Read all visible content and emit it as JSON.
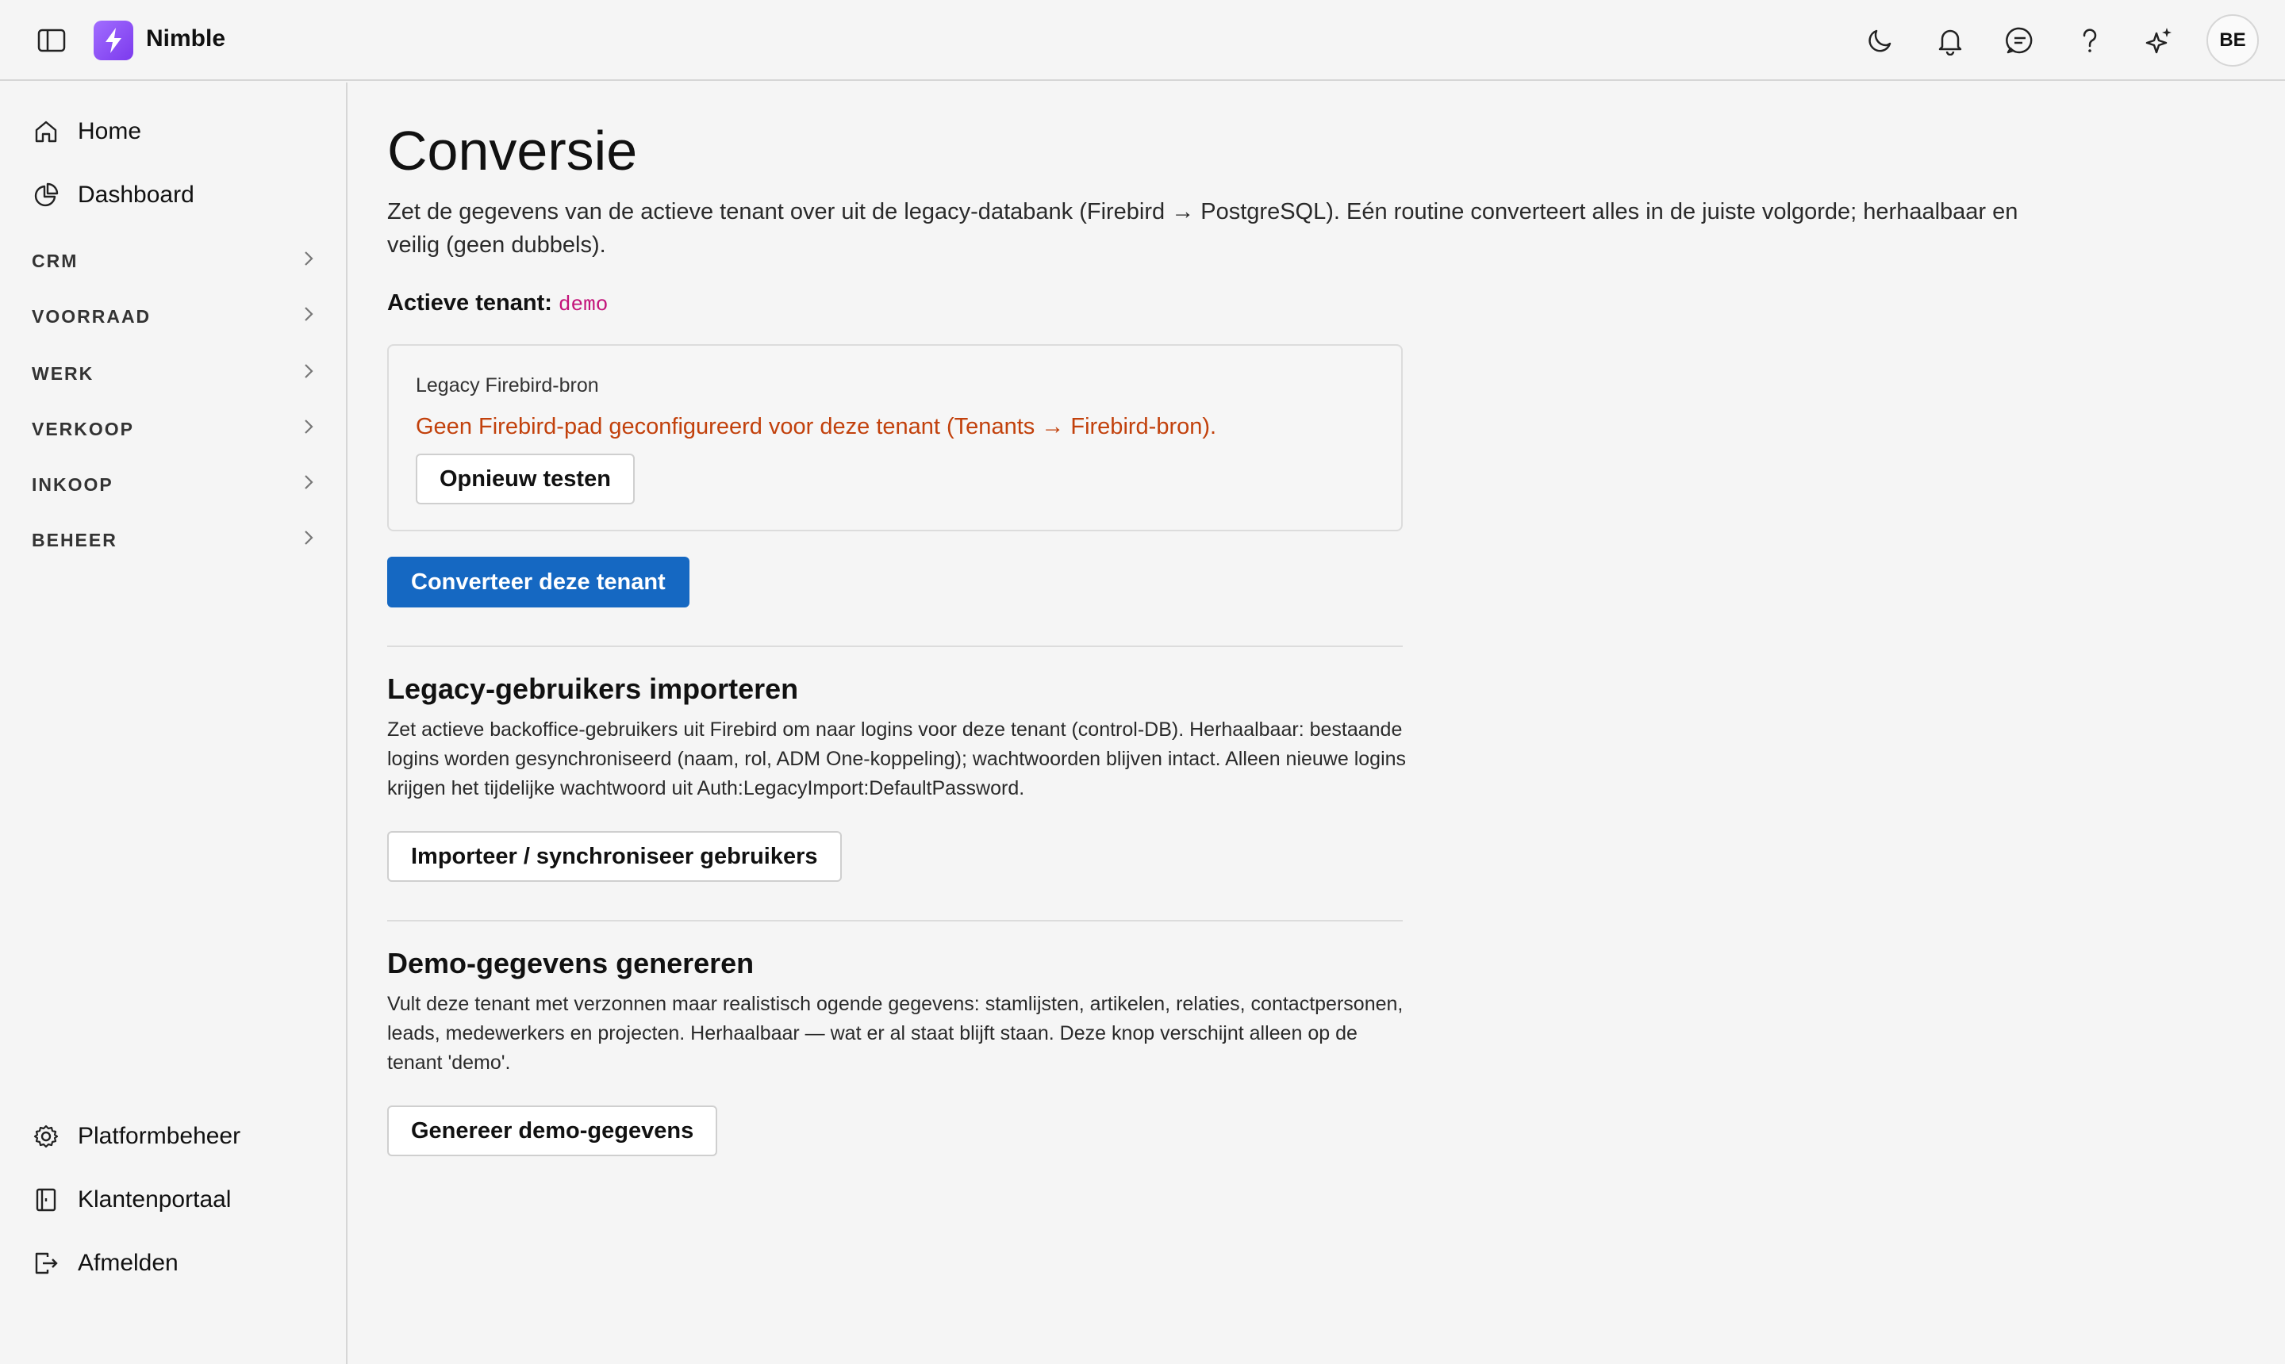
{
  "app": {
    "brand_name": "Nimble",
    "accent_color": "#7c3aed",
    "user_initials": "BE",
    "header_icons": [
      "sidebar-toggle-icon",
      "moon-icon",
      "bell-icon",
      "chat-icon",
      "help-icon",
      "sparkle-icon"
    ]
  },
  "sidebar": {
    "top_items": [
      {
        "label": "Home",
        "icon": "home-icon"
      },
      {
        "label": "Dashboard",
        "icon": "pie-chart-icon"
      }
    ],
    "sections": [
      {
        "label": "CRM"
      },
      {
        "label": "VOORRAAD"
      },
      {
        "label": "WERK"
      },
      {
        "label": "VERKOOP"
      },
      {
        "label": "INKOOP"
      },
      {
        "label": "BEHEER"
      }
    ],
    "bottom_items": [
      {
        "label": "Platformbeheer",
        "icon": "gear-icon"
      },
      {
        "label": "Klantenportaal",
        "icon": "book-icon"
      },
      {
        "label": "Afmelden",
        "icon": "logout-icon"
      }
    ]
  },
  "main": {
    "title": "Conversie",
    "intro": "Zet de gegevens van de actieve tenant over uit de legacy-databank (Firebird → PostgreSQL). Eén routine converteert alles in de juiste volgorde; herhaalbaar en veilig (geen dubbels).",
    "tenant_label": "Actieve tenant:",
    "tenant_value": "demo",
    "source_card": {
      "label": "Legacy Firebird-bron",
      "error": "Geen Firebird-pad geconfigureerd voor deze tenant (Tenants → Firebird-bron).",
      "retest_button": "Opnieuw testen",
      "error_color": "#c2410c"
    },
    "convert_button": "Converteer deze tenant",
    "primary_color": "#1568c2",
    "users_section": {
      "title": "Legacy-gebruikers importeren",
      "text": "Zet actieve backoffice-gebruikers uit Firebird om naar logins voor deze tenant (control-DB). Herhaalbaar: bestaande logins worden gesynchroniseerd (naam, rol, ADM One-koppeling); wachtwoorden blijven intact. Alleen nieuwe logins krijgen het tijdelijke wachtwoord uit Auth:LegacyImport:DefaultPassword.",
      "button": "Importeer / synchroniseer gebruikers"
    },
    "demo_section": {
      "title": "Demo-gegevens genereren",
      "text": "Vult deze tenant met verzonnen maar realistisch ogende gegevens: stamlijsten, artikelen, relaties, contactpersonen, leads, medewerkers en projecten. Herhaalbaar — wat er al staat blijft staan. Deze knop verschijnt alleen op de tenant 'demo'.",
      "button": "Genereer demo-gegevens"
    }
  }
}
